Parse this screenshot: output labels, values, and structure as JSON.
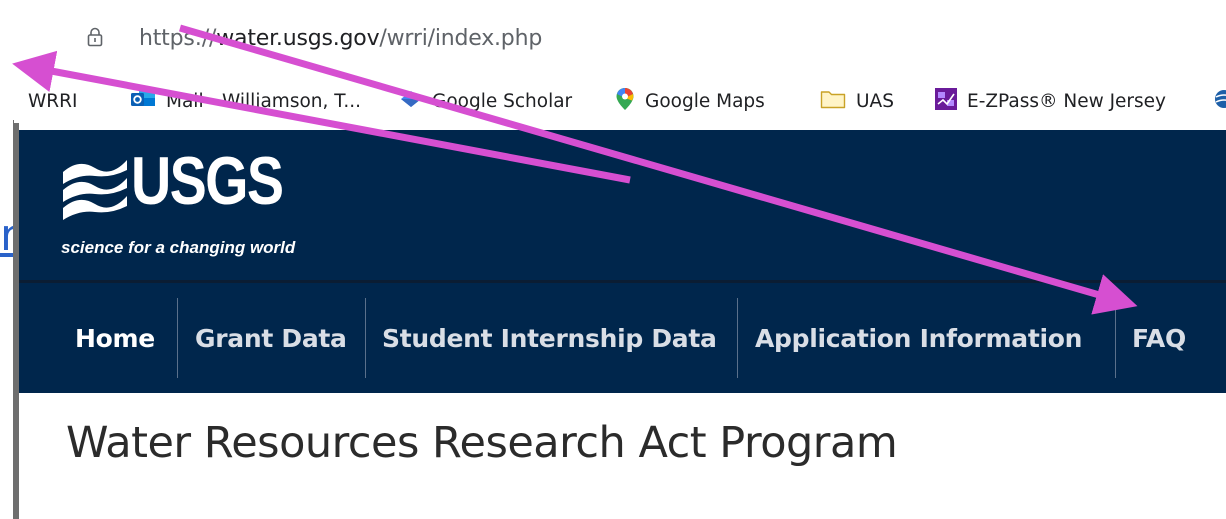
{
  "browser": {
    "url_prefix": "https://",
    "url_host": "water.usgs.gov",
    "url_path": "/wrri/index.php",
    "bookmarks": [
      {
        "label": "WRRI",
        "icon": "generic-icon"
      },
      {
        "label": "Mail - Williamson, T...",
        "icon": "outlook-icon"
      },
      {
        "label": "Google Scholar",
        "icon": "scholar-icon"
      },
      {
        "label": "Google Maps",
        "icon": "maps-pin-icon"
      },
      {
        "label": "UAS",
        "icon": "folder-icon"
      },
      {
        "label": "E-ZPass® New Jersey",
        "icon": "ezpass-icon"
      }
    ]
  },
  "fragment_link_text": "n",
  "header": {
    "logo_text": "USGS",
    "tagline": "science for a changing world"
  },
  "nav": {
    "items": [
      "Home",
      "Grant Data",
      "Student Internship Data",
      "Application Information",
      "FAQ"
    ]
  },
  "page": {
    "title": "Water Resources Research Act Program"
  },
  "colors": {
    "header_bg": "#00264c",
    "arrow": "#d64fd1",
    "link": "#2a62c9"
  }
}
